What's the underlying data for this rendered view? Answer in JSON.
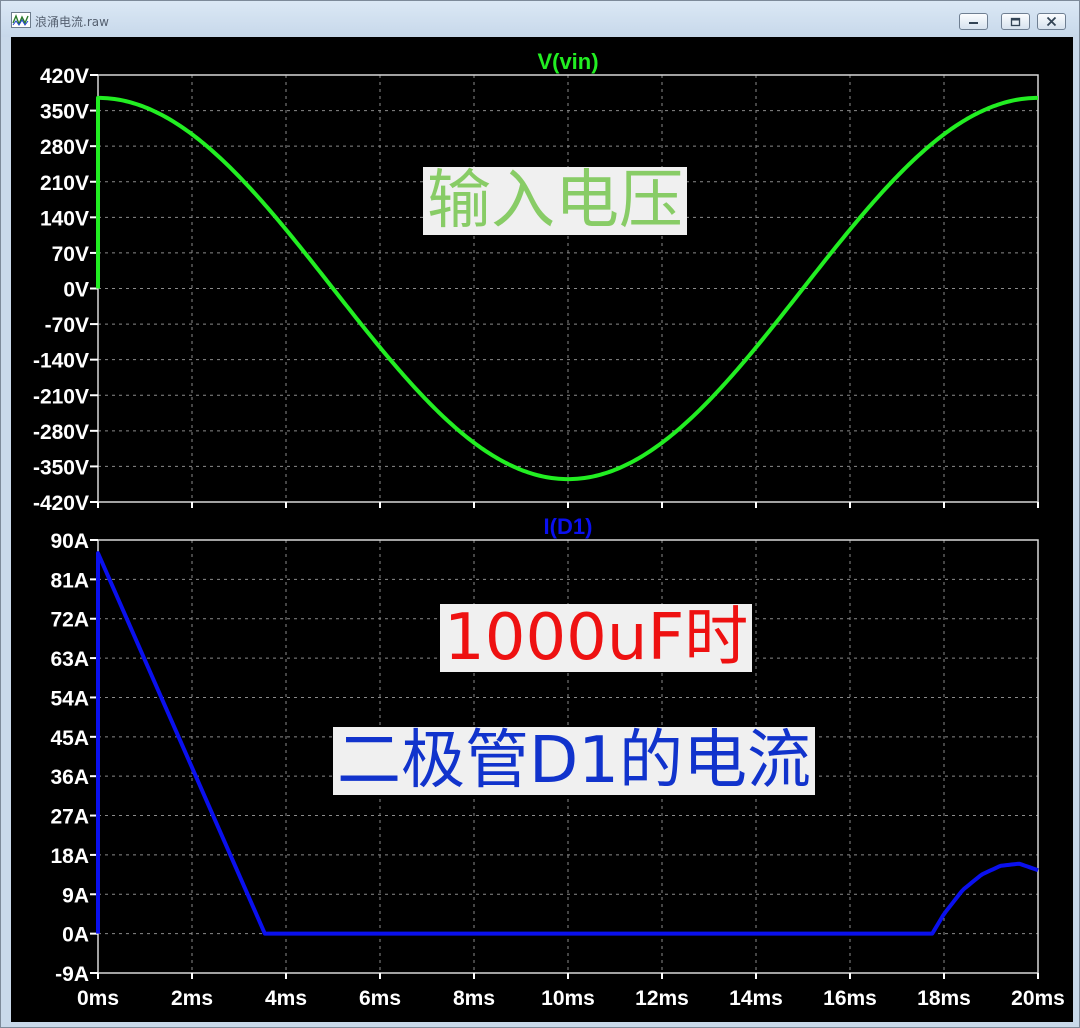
{
  "window": {
    "title": "浪涌电流.raw",
    "icon": "waveform-icon",
    "buttons": [
      "minimize-icon",
      "restore-icon",
      "close-icon"
    ]
  },
  "colors": {
    "voltage_trace": "#22ee22",
    "current_trace": "#0a10ee",
    "voltage_annotation": "#88cc66",
    "annotation_red": "#ee1111",
    "annotation_blue": "#1133cc",
    "grid": "#8a8a8a",
    "axis_text": "#ffffff",
    "plot_background": "#000000"
  },
  "annotations": {
    "voltage_label": "输入电压",
    "cap_label": "1000uF时",
    "current_label": "二极管D1的电流"
  },
  "chart_data": [
    {
      "type": "line",
      "title": "V(vin)",
      "xlabel": "",
      "ylabel": "",
      "xlim": [
        0,
        20
      ],
      "ylim": [
        -420,
        420
      ],
      "x_unit": "ms",
      "y_unit": "V",
      "xticks": [
        0,
        2,
        4,
        6,
        8,
        10,
        12,
        14,
        16,
        18,
        20
      ],
      "yticks": [
        420,
        350,
        280,
        210,
        140,
        70,
        0,
        -70,
        -140,
        -210,
        -280,
        -350,
        -420
      ],
      "xtick_labels": [
        "0ms",
        "2ms",
        "4ms",
        "6ms",
        "8ms",
        "10ms",
        "12ms",
        "14ms",
        "16ms",
        "18ms",
        "20ms"
      ],
      "ytick_labels": [
        "420V",
        "350V",
        "280V",
        "210V",
        "140V",
        "70V",
        "0V",
        "-70V",
        "-140V",
        "-210V",
        "-280V",
        "-350V",
        "-420V"
      ],
      "grid": true,
      "series": [
        {
          "color": "#22ee22",
          "x": [
            0,
            0,
            1,
            2,
            3,
            4,
            5,
            6,
            7,
            8,
            9,
            10,
            11,
            12,
            13,
            14,
            15,
            16,
            17,
            18,
            19,
            20
          ],
          "y": [
            0,
            375,
            357,
            303,
            220,
            116,
            0,
            -116,
            -220,
            -303,
            -357,
            -375,
            -357,
            -303,
            -220,
            -116,
            0,
            116,
            220,
            303,
            357,
            375
          ]
        }
      ]
    },
    {
      "type": "line",
      "title": "I(D1)",
      "xlabel": "",
      "ylabel": "",
      "xlim": [
        0,
        20
      ],
      "ylim": [
        -9,
        90
      ],
      "x_unit": "ms",
      "y_unit": "A",
      "xticks": [
        0,
        2,
        4,
        6,
        8,
        10,
        12,
        14,
        16,
        18,
        20
      ],
      "yticks": [
        90,
        81,
        72,
        63,
        54,
        45,
        36,
        27,
        18,
        9,
        0,
        -9
      ],
      "xtick_labels": [
        "0ms",
        "2ms",
        "4ms",
        "6ms",
        "8ms",
        "10ms",
        "12ms",
        "14ms",
        "16ms",
        "18ms",
        "20ms"
      ],
      "ytick_labels": [
        "90A",
        "81A",
        "72A",
        "63A",
        "54A",
        "45A",
        "36A",
        "27A",
        "18A",
        "9A",
        "0A",
        "-9A"
      ],
      "grid": true,
      "series": [
        {
          "color": "#0a10ee",
          "x": [
            0,
            0,
            3.55,
            17.75,
            18.0,
            18.4,
            18.8,
            19.2,
            19.6,
            20.0
          ],
          "y": [
            0,
            87,
            0,
            0,
            4.5,
            10,
            13.5,
            15.5,
            16,
            14.5
          ]
        }
      ]
    }
  ]
}
